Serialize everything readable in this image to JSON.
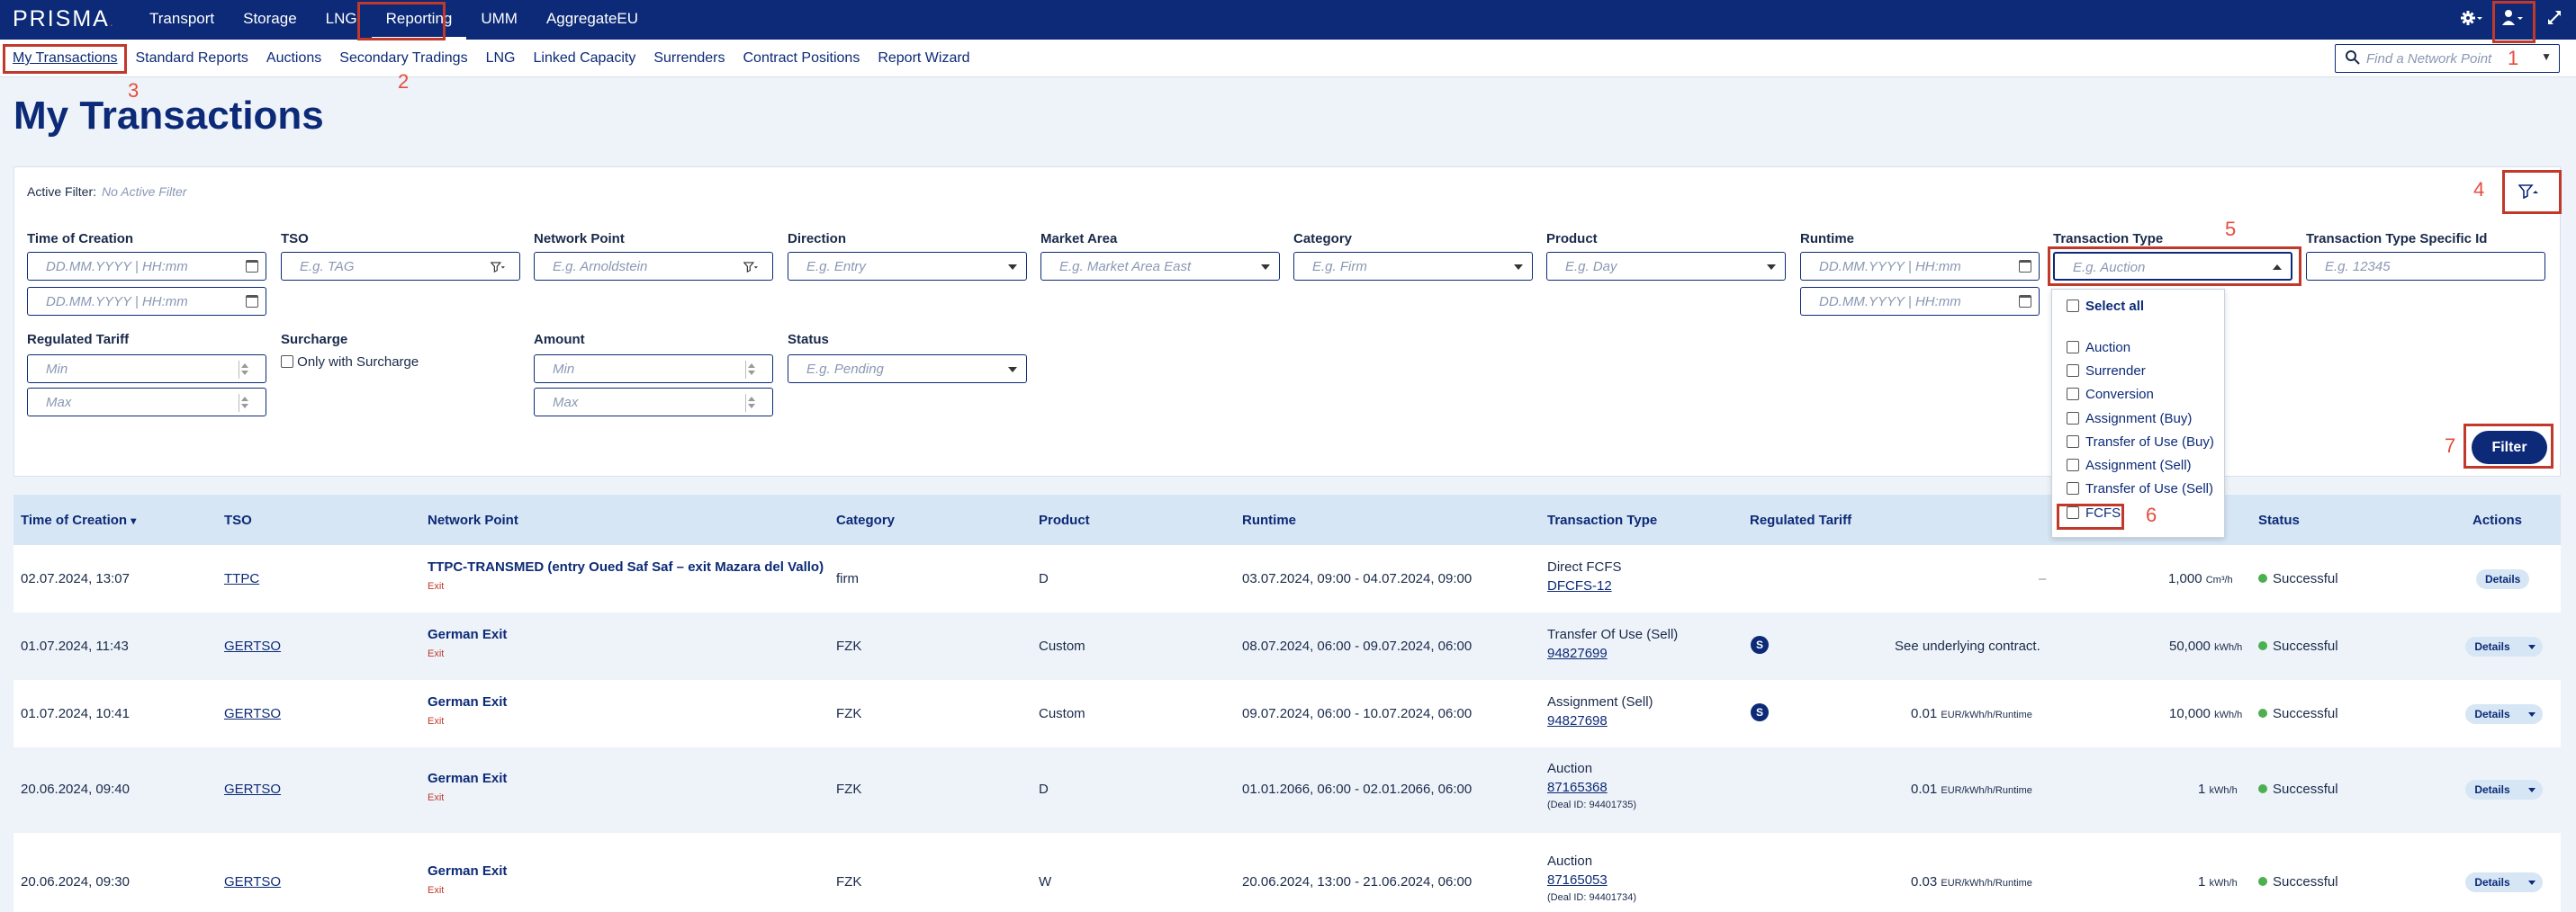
{
  "brand": {
    "logo": "PRISMA",
    "logo_dot": "."
  },
  "topnav": [
    "Transport",
    "Storage",
    "LNG",
    "Reporting",
    "UMM",
    "AggregateEU"
  ],
  "subnav": [
    "My Transactions",
    "Standard Reports",
    "Auctions",
    "Secondary Tradings",
    "LNG",
    "Linked Capacity",
    "Surrenders",
    "Contract Positions",
    "Report Wizard"
  ],
  "search": {
    "placeholder": "Find a Network Point"
  },
  "page_title": "My Transactions",
  "annotations": [
    "1",
    "2",
    "3",
    "4",
    "5",
    "6",
    "7"
  ],
  "filters": {
    "active_filter_label": "Active Filter:",
    "active_filter_value": "No Active Filter",
    "time_of_creation": {
      "label": "Time of Creation",
      "from_ph": "DD.MM.YYYY | HH:mm",
      "to_ph": "DD.MM.YYYY | HH:mm"
    },
    "tso": {
      "label": "TSO",
      "ph": "E.g. TAG"
    },
    "network_point": {
      "label": "Network Point",
      "ph": "E.g. Arnoldstein"
    },
    "direction": {
      "label": "Direction",
      "ph": "E.g. Entry"
    },
    "market_area": {
      "label": "Market Area",
      "ph": "E.g. Market Area East"
    },
    "category": {
      "label": "Category",
      "ph": "E.g. Firm"
    },
    "product": {
      "label": "Product",
      "ph": "E.g. Day"
    },
    "runtime": {
      "label": "Runtime",
      "from_ph": "DD.MM.YYYY | HH:mm",
      "to_ph": "DD.MM.YYYY | HH:mm"
    },
    "transaction_type": {
      "label": "Transaction Type",
      "ph": "E.g. Auction"
    },
    "transaction_type_id": {
      "label": "Transaction Type Specific Id",
      "ph": "E.g. 12345"
    },
    "regulated_tariff": {
      "label": "Regulated Tariff",
      "min_ph": "Min",
      "max_ph": "Max"
    },
    "surcharge": {
      "label": "Surcharge",
      "option": "Only with Surcharge"
    },
    "amount": {
      "label": "Amount",
      "min_ph": "Min",
      "max_ph": "Max"
    },
    "status": {
      "label": "Status",
      "ph": "E.g. Pending"
    },
    "filter_button": "Filter"
  },
  "transaction_type_options": {
    "select_all": "Select all",
    "items": [
      "Auction",
      "Surrender",
      "Conversion",
      "Assignment (Buy)",
      "Transfer of Use (Buy)",
      "Assignment (Sell)",
      "Transfer of Use (Sell)",
      "FCFS"
    ]
  },
  "table": {
    "headers": [
      "Time of Creation",
      "TSO",
      "Network Point",
      "Category",
      "Product",
      "Runtime",
      "Transaction Type",
      "Regulated Tariff",
      "Status",
      "Actions"
    ],
    "rows": [
      {
        "time": "02.07.2024, 13:07",
        "tso": "TTPC",
        "np": "TTPC-TRANSMED (entry Oued Saf Saf – exit Mazara del Vallo)",
        "np_sub": "Exit",
        "category": "firm",
        "product": "D",
        "runtime": "03.07.2024, 09:00 - 04.07.2024, 09:00",
        "tt": "Direct FCFS",
        "tt_id": "DFCFS-12",
        "tt_deal": "",
        "tariff": "–",
        "tariff_unit": "",
        "amount": "1,000",
        "amount_unit": "Cm³/h",
        "status": "Successful",
        "action": "Details"
      },
      {
        "time": "01.07.2024, 11:43",
        "tso": "GERTSO",
        "np": "German Exit",
        "np_sub": "Exit",
        "category": "FZK",
        "product": "Custom",
        "runtime": "08.07.2024, 06:00 - 09.07.2024, 06:00",
        "tt": "Transfer Of Use (Sell)",
        "tt_id": "94827699",
        "tt_deal": "",
        "badge": "S",
        "tariff": "See underlying contract.",
        "tariff_unit": "",
        "amount": "50,000",
        "amount_unit": "kWh/h",
        "status": "Successful",
        "action": "Details"
      },
      {
        "time": "01.07.2024, 10:41",
        "tso": "GERTSO",
        "np": "German Exit",
        "np_sub": "Exit",
        "category": "FZK",
        "product": "Custom",
        "runtime": "09.07.2024, 06:00 - 10.07.2024, 06:00",
        "tt": "Assignment (Sell)",
        "tt_id": "94827698",
        "tt_deal": "",
        "badge": "S",
        "tariff": "0.01",
        "tariff_unit": "EUR/kWh/h/Runtime",
        "amount": "10,000",
        "amount_unit": "kWh/h",
        "status": "Successful",
        "action": "Details"
      },
      {
        "time": "20.06.2024, 09:40",
        "tso": "GERTSO",
        "np": "German Exit",
        "np_sub": "Exit",
        "category": "FZK",
        "product": "D",
        "runtime": "01.01.2066, 06:00 - 02.01.2066, 06:00",
        "tt": "Auction",
        "tt_id": "87165368",
        "tt_deal": "(Deal ID: 94401735)",
        "tariff": "0.01",
        "tariff_unit": "EUR/kWh/h/Runtime",
        "amount": "1",
        "amount_unit": "kWh/h",
        "status": "Successful",
        "action": "Details"
      },
      {
        "time": "20.06.2024, 09:30",
        "tso": "GERTSO",
        "np": "German Exit",
        "np_sub": "Exit",
        "category": "FZK",
        "product": "W",
        "runtime": "20.06.2024, 13:00 - 21.06.2024, 06:00",
        "tt": "Auction",
        "tt_id": "87165053",
        "tt_deal": "(Deal ID: 94401734)",
        "tariff": "0.03",
        "tariff_unit": "EUR/kWh/h/Runtime",
        "amount": "1",
        "amount_unit": "kWh/h",
        "status": "Successful",
        "action": "Details"
      }
    ]
  }
}
